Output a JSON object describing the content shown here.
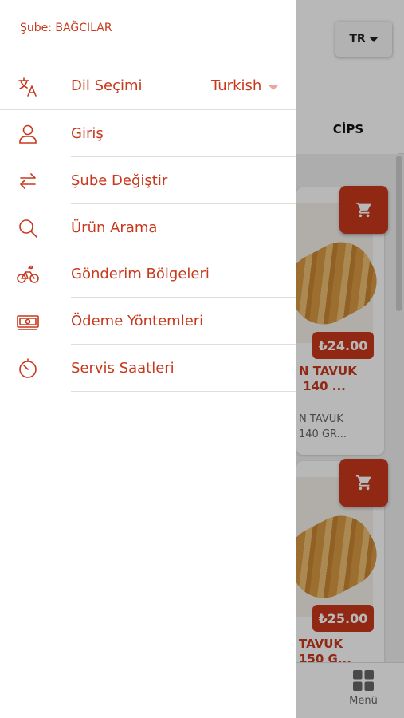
{
  "background": {
    "language_button": "TR",
    "tab": "CİPS",
    "products": [
      {
        "price": "₺24.00",
        "name": "N TAVUK\n 140 ...",
        "description": "N TAVUK\n140 GR..."
      },
      {
        "price": "₺25.00",
        "name": "TAVUK\n150 G...",
        "description": ""
      }
    ],
    "bottom_nav": {
      "menu_label": "Menü"
    }
  },
  "drawer": {
    "branch": "Şube: BAĞCILAR",
    "language": {
      "label": "Dil Seçimi",
      "value": "Turkish"
    },
    "items": [
      {
        "label": "Giriş",
        "icon": "user-icon"
      },
      {
        "label": "Şube Değiştir",
        "icon": "swap-icon"
      },
      {
        "label": "Ürün Arama",
        "icon": "search-icon"
      },
      {
        "label": "Gönderim Bölgeleri",
        "icon": "bicycle-icon"
      },
      {
        "label": "Ödeme Yöntemleri",
        "icon": "cash-icon"
      },
      {
        "label": "Servis Saatleri",
        "icon": "timer-icon"
      }
    ]
  },
  "colors": {
    "accent": "#c8381c",
    "divider": "#dddddd",
    "overlay": "rgba(0,0,0,0.28)"
  }
}
